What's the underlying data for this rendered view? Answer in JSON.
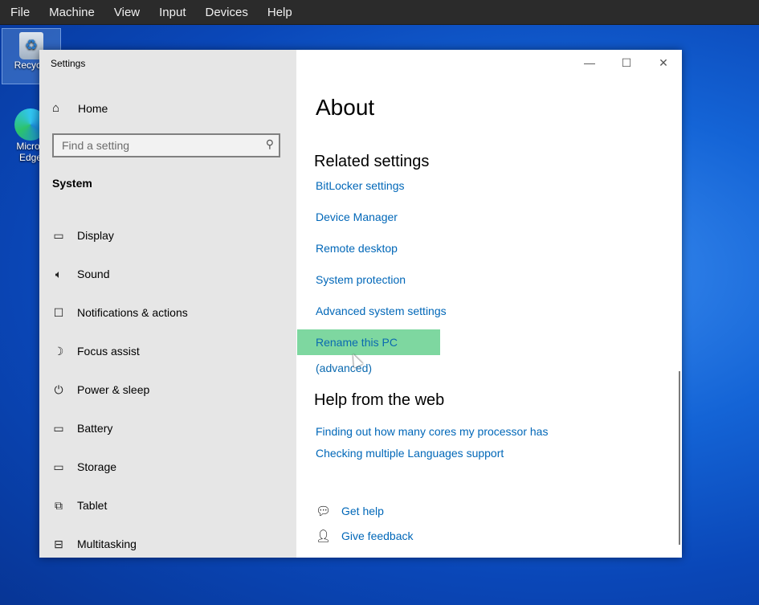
{
  "menubar": {
    "items": [
      "File",
      "Machine",
      "View",
      "Input",
      "Devices",
      "Help"
    ]
  },
  "desktop": {
    "recycle_label": "Recycle",
    "edge_label_line1": "Micros",
    "edge_label_line2": "Edge"
  },
  "window": {
    "title": "Settings",
    "controls": {
      "minimize": "—",
      "maximize": "☐",
      "close": "✕"
    }
  },
  "sidebar": {
    "home_label": "Home",
    "search_placeholder": "Find a setting",
    "section_label": "System",
    "items": [
      {
        "label": "Display",
        "icon": "display-icon",
        "glyph": "▭"
      },
      {
        "label": "Sound",
        "icon": "sound-icon",
        "glyph": "🔈︎"
      },
      {
        "label": "Notifications & actions",
        "icon": "notifications-icon",
        "glyph": "☐"
      },
      {
        "label": "Focus assist",
        "icon": "moon-icon",
        "glyph": "☽"
      },
      {
        "label": "Power & sleep",
        "icon": "power-icon",
        "glyph": "⏻"
      },
      {
        "label": "Battery",
        "icon": "battery-icon",
        "glyph": "▭"
      },
      {
        "label": "Storage",
        "icon": "storage-icon",
        "glyph": "▭"
      },
      {
        "label": "Tablet",
        "icon": "tablet-icon",
        "glyph": "⧉"
      },
      {
        "label": "Multitasking",
        "icon": "multitasking-icon",
        "glyph": "⊟"
      }
    ]
  },
  "main": {
    "title": "About",
    "related_title": "Related settings",
    "related_links": [
      "BitLocker settings",
      "Device Manager",
      "Remote desktop",
      "System protection",
      "Advanced system settings"
    ],
    "highlighted_link": "Rename this PC (advanced)",
    "help_title": "Help from the web",
    "help_links": [
      "Finding out how many cores my processor has",
      "Checking multiple Languages support"
    ],
    "get_help": "Get help",
    "give_feedback": "Give feedback"
  },
  "colors": {
    "link": "#0067b8",
    "highlight": "#7ed7a0",
    "sidebar_bg": "#e6e6e6"
  }
}
